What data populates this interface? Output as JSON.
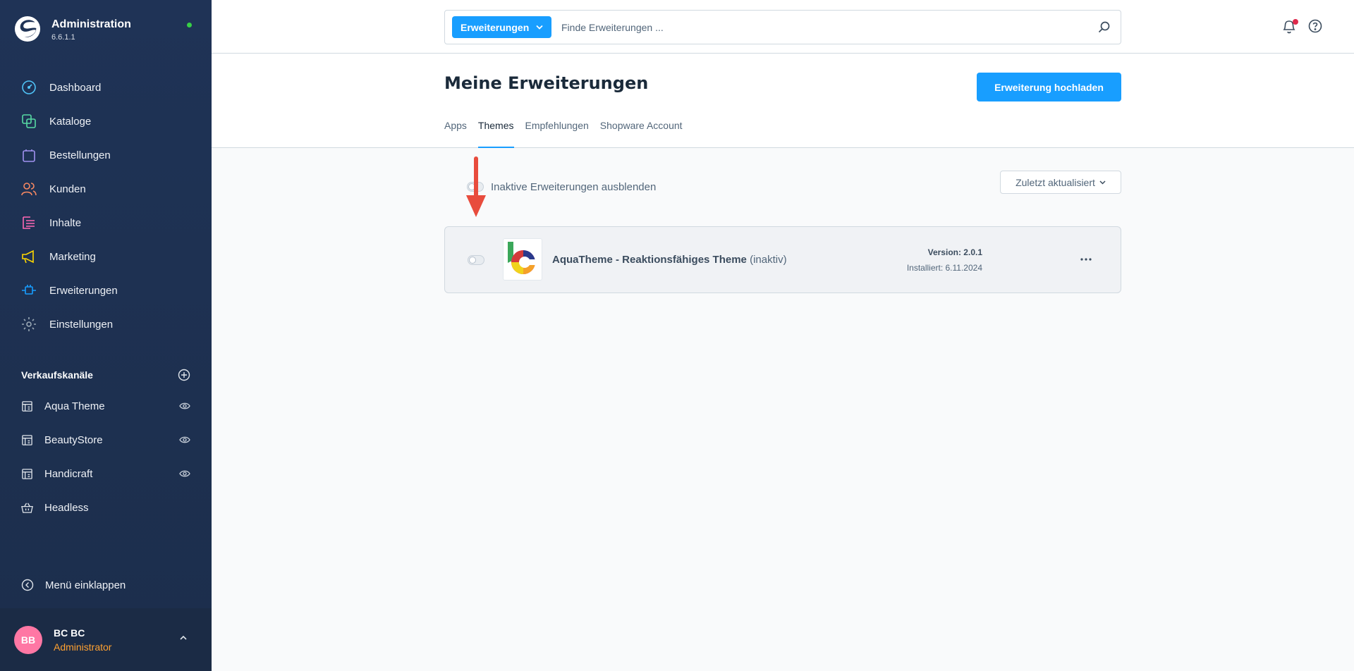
{
  "app": {
    "title": "Administration",
    "version": "6.6.1.1"
  },
  "sidebar": {
    "items": [
      {
        "label": "Dashboard",
        "icon": "dashboard-icon",
        "color": "#4fc3f7"
      },
      {
        "label": "Kataloge",
        "icon": "catalog-icon",
        "color": "#57d9a3"
      },
      {
        "label": "Bestellungen",
        "icon": "orders-icon",
        "color": "#a092f0"
      },
      {
        "label": "Kunden",
        "icon": "customers-icon",
        "color": "#f88962"
      },
      {
        "label": "Inhalte",
        "icon": "content-icon",
        "color": "#ff68b4"
      },
      {
        "label": "Marketing",
        "icon": "marketing-icon",
        "color": "#ffd700"
      },
      {
        "label": "Erweiterungen",
        "icon": "extensions-icon",
        "color": "#189eff"
      },
      {
        "label": "Einstellungen",
        "icon": "settings-icon",
        "color": "#9aa8b5"
      }
    ],
    "sales_channels": {
      "title": "Verkaufskanäle",
      "items": [
        {
          "label": "Aqua Theme"
        },
        {
          "label": "BeautyStore"
        },
        {
          "label": "Handicraft"
        },
        {
          "label": "Headless"
        }
      ]
    },
    "collapse_label": "Menü einklappen"
  },
  "user": {
    "initials": "BB",
    "name": "BC BC",
    "role": "Administrator"
  },
  "search": {
    "type_label": "Erweiterungen",
    "placeholder": "Finde Erweiterungen ..."
  },
  "page": {
    "title": "Meine Erweiterungen",
    "upload_label": "Erweiterung hochladen",
    "tabs": [
      {
        "label": "Apps",
        "active": false
      },
      {
        "label": "Themes",
        "active": true
      },
      {
        "label": "Empfehlungen",
        "active": false
      },
      {
        "label": "Shopware Account",
        "active": false
      }
    ]
  },
  "filter": {
    "hide_inactive_label": "Inaktive Erweiterungen ausblenden",
    "sort_label": "Zuletzt aktualisiert"
  },
  "extension": {
    "name": "AquaTheme - Reaktionsfähiges Theme",
    "status": "(inaktiv)",
    "version": "Version: 2.0.1",
    "installed": "Installiert: 6.11.2024",
    "active": false
  },
  "colors": {
    "accent": "#189eff",
    "sidebar_bg": "#1f3356",
    "annotation_arrow": "#e84c3d"
  }
}
